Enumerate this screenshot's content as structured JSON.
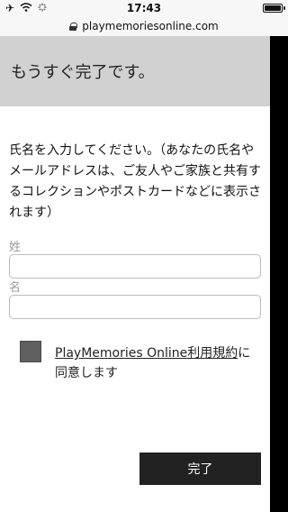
{
  "status_bar": {
    "time": "17:43"
  },
  "url_bar": {
    "domain": "playmemoriesonline.com"
  },
  "page": {
    "title": "もうすぐ完了です。",
    "description": "氏名を入力してください。（あなたの氏名やメールアドレスは、ご友人やご家族と共有するコレクションやポストカードなどに表示されます）",
    "last_name_label": "姓",
    "first_name_label": "名",
    "agree_link_text": "PlayMemories Online利用規約",
    "agree_suffix": "に同意します",
    "done_button": "完了"
  }
}
